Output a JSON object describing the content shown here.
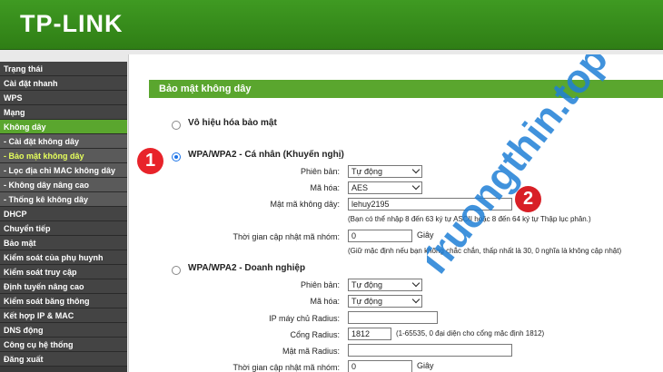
{
  "header": {
    "logo": "TP-LINK"
  },
  "sidebar": {
    "items": [
      {
        "label": "Trạng thái",
        "type": "main"
      },
      {
        "label": "Cài đặt nhanh",
        "type": "main"
      },
      {
        "label": "WPS",
        "type": "main"
      },
      {
        "label": "Mạng",
        "type": "main"
      },
      {
        "label": "Không dây",
        "type": "active"
      },
      {
        "label": "- Cài đặt không dây",
        "type": "sub"
      },
      {
        "label": "- Bảo mật không dây",
        "type": "current"
      },
      {
        "label": "- Lọc địa chỉ MAC không dây",
        "type": "sub"
      },
      {
        "label": "- Không dây nâng cao",
        "type": "sub"
      },
      {
        "label": "- Thống kê không dây",
        "type": "sub"
      },
      {
        "label": "DHCP",
        "type": "main"
      },
      {
        "label": "Chuyển tiếp",
        "type": "main"
      },
      {
        "label": "Bảo mật",
        "type": "main"
      },
      {
        "label": "Kiểm soát của phụ huynh",
        "type": "main"
      },
      {
        "label": "Kiểm soát truy cập",
        "type": "main"
      },
      {
        "label": "Định tuyến nâng cao",
        "type": "main"
      },
      {
        "label": "Kiểm soát băng thông",
        "type": "main"
      },
      {
        "label": "Kết hợp IP & MAC",
        "type": "main"
      },
      {
        "label": "DNS động",
        "type": "main"
      },
      {
        "label": "Công cụ hệ thống",
        "type": "main"
      },
      {
        "label": "Đăng xuất",
        "type": "main"
      }
    ]
  },
  "main": {
    "title": "Bảo mật không dây",
    "disable": {
      "label": "Vô hiệu hóa bảo mật",
      "checked": false
    },
    "personal": {
      "label": "WPA/WPA2 - Cá nhân (Khuyến nghị)",
      "checked": true,
      "version_label": "Phiên bản:",
      "version_value": "Tự động",
      "encryption_label": "Mã hóa:",
      "encryption_value": "AES",
      "password_label": "Mật mã không dây:",
      "password_value": "lehuy2195",
      "password_hint": "(Bạn có thể nhập 8 đến 63 ký tự ASCII hoặc 8 đến 64 ký tự Thập lục phân.)",
      "group_key_label": "Thời gian cập nhật mã nhóm:",
      "group_key_value": "0",
      "group_key_unit": "Giây",
      "group_key_hint": "(Giữ mặc định nếu bạn không chắc chắn, thấp nhất là 30, 0 nghĩa là không cập nhật)"
    },
    "enterprise": {
      "label": "WPA/WPA2 - Doanh nghiệp",
      "checked": false,
      "version_label": "Phiên bản:",
      "version_value": "Tự động",
      "encryption_label": "Mã hóa:",
      "encryption_value": "Tự động",
      "radius_ip_label": "IP máy chủ Radius:",
      "radius_ip_value": "",
      "radius_port_label": "Cổng Radius:",
      "radius_port_value": "1812",
      "radius_port_hint": "(1-65535, 0 đại diện cho cổng mặc định 1812)",
      "radius_pass_label": "Mật mã Radius:",
      "radius_pass_value": "",
      "group_key_label": "Thời gian cập nhật mã nhóm:",
      "group_key_value": "0",
      "group_key_unit": "Giây"
    }
  },
  "annotations": {
    "badge1": "1",
    "badge2": "2"
  },
  "watermark": {
    "text": "Truongthin.top"
  },
  "colors": {
    "accent": "#5aa62e",
    "header": "#3f9a22",
    "sidebar": "#444444",
    "badge": "#e8232a",
    "watermark": "#1e7fd6"
  }
}
